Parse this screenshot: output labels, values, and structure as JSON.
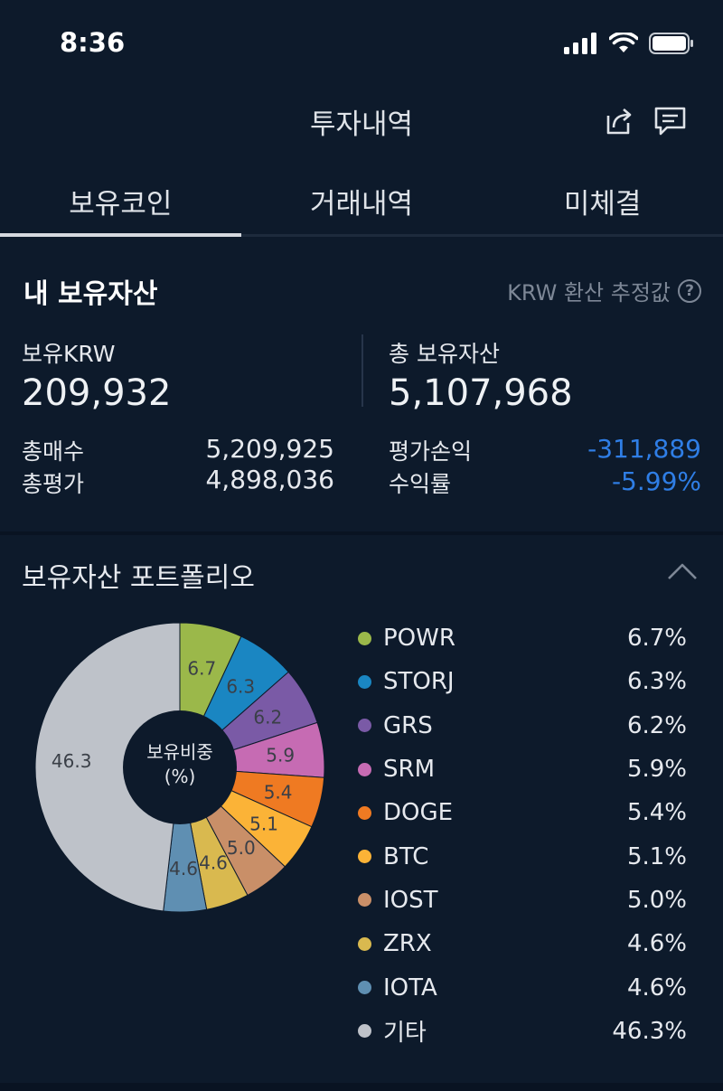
{
  "status_bar": {
    "time": "8:36"
  },
  "nav": {
    "title": "투자내역",
    "share_icon": "share-icon",
    "chat_icon": "message-icon"
  },
  "tabs": [
    {
      "label": "보유코인",
      "active": true
    },
    {
      "label": "거래내역",
      "active": false
    },
    {
      "label": "미체결",
      "active": false
    }
  ],
  "assets": {
    "title": "내 보유자산",
    "krw_note": "KRW 환산 추정값",
    "krw_label": "보유KRW",
    "krw_value": "209,932",
    "total_label": "총 보유자산",
    "total_value": "5,107,968",
    "buy_label": "총매수",
    "buy_value": "5,209,925",
    "eval_label": "총평가",
    "eval_value": "4,898,036",
    "pnl_label": "평가손익",
    "pnl_value": "-311,889",
    "rate_label": "수익률",
    "rate_value": "-5.99%"
  },
  "portfolio": {
    "title": "보유자산 포트폴리오",
    "center_label_1": "보유비중",
    "center_label_2": "(%)"
  },
  "chart_data": {
    "type": "pie",
    "title": "",
    "categories": [
      "POWR",
      "STORJ",
      "GRS",
      "SRM",
      "DOGE",
      "BTC",
      "IOST",
      "ZRX",
      "IOTA",
      "기타"
    ],
    "values": [
      6.7,
      6.3,
      6.2,
      5.9,
      5.4,
      5.1,
      5.0,
      4.6,
      4.6,
      46.3
    ],
    "slice_labels": [
      "6.7",
      "6.3",
      "6.2",
      "5.9",
      "5.4",
      "5.1",
      "5.0",
      "4.6",
      "4.6",
      "46.3"
    ],
    "legend_values": [
      "6.7%",
      "6.3%",
      "6.2%",
      "5.9%",
      "5.4%",
      "5.1%",
      "5.0%",
      "4.6%",
      "4.6%",
      "46.3%"
    ],
    "colors": [
      "#9bb84a",
      "#1a86c2",
      "#7a5aa6",
      "#c66bb3",
      "#ef7a22",
      "#fbb337",
      "#c98f68",
      "#d9b94f",
      "#5f8fb2",
      "#bec2c9"
    ],
    "legend_placement": "right"
  }
}
